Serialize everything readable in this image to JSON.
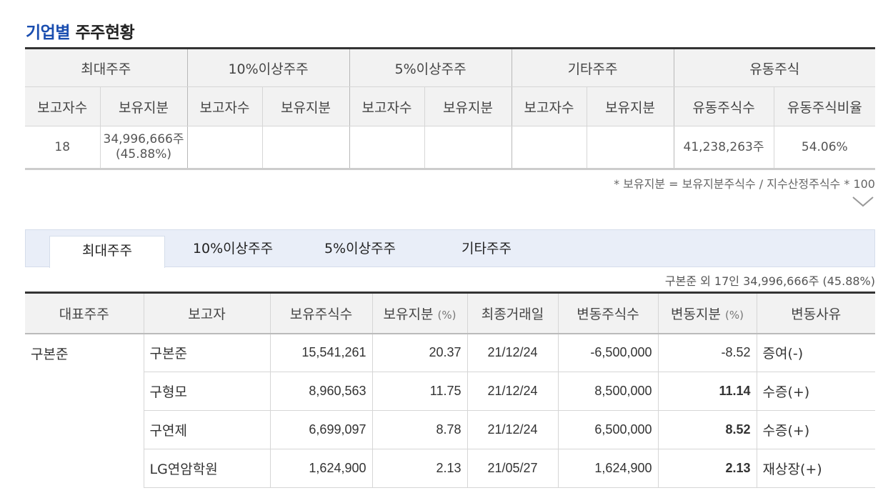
{
  "title": {
    "highlight": "기업별",
    "rest": "주주현황"
  },
  "summary": {
    "groups": [
      "최대주주",
      "10%이상주주",
      "5%이상주주",
      "기타주주",
      "유동주식"
    ],
    "subheaders": [
      "보고자수",
      "보유지분",
      "보고자수",
      "보유지분",
      "보고자수",
      "보유지분",
      "보고자수",
      "보유지분",
      "유동주식수",
      "유동주식비율"
    ],
    "row": {
      "largest_count": "18",
      "largest_shares": "34,996,666주",
      "largest_ratio": "(45.88%)",
      "pct10_count": "",
      "pct10_shares": "",
      "pct5_count": "",
      "pct5_shares": "",
      "other_count": "",
      "other_shares": "",
      "float_shares": "41,238,263주",
      "float_ratio": "54.06%"
    },
    "note": "* 보유지분 = 보유지분주식수 / 지수산정주식수 * 100"
  },
  "tabs": [
    "최대주주",
    "10%이상주주",
    "5%이상주주",
    "기타주주"
  ],
  "detail": {
    "summary_note": "구본준 외 17인 34,996,666주 (45.88%)",
    "headers": {
      "rep": "대표주주",
      "reporter": "보고자",
      "shares": "보유주식수",
      "ratio": "보유지분",
      "ratio_unit": "(%)",
      "last_trade": "최종거래일",
      "change_shares": "변동주식수",
      "change_ratio": "변동지분",
      "change_ratio_unit": "(%)",
      "reason": "변동사유"
    },
    "rows": [
      {
        "rep": "구본준",
        "reporter": "구본준",
        "shares": "15,541,261",
        "ratio": "20.37",
        "date": "21/12/24",
        "change": "-6,500,000",
        "change_ratio": "-8.52",
        "reason": "증여(-)"
      },
      {
        "rep": "",
        "reporter": "구형모",
        "shares": "8,960,563",
        "ratio": "11.75",
        "date": "21/12/24",
        "change": "8,500,000",
        "change_ratio": "11.14",
        "reason": "수증(+)"
      },
      {
        "rep": "",
        "reporter": "구연제",
        "shares": "6,699,097",
        "ratio": "8.78",
        "date": "21/12/24",
        "change": "6,500,000",
        "change_ratio": "8.52",
        "reason": "수증(+)"
      },
      {
        "rep": "",
        "reporter": "LG연암학원",
        "shares": "1,624,900",
        "ratio": "2.13",
        "date": "21/05/27",
        "change": "1,624,900",
        "change_ratio": "2.13",
        "reason": "재상장(+)"
      }
    ]
  },
  "colors": {
    "accent": "#1a4eb0",
    "negative": "#d0021b"
  }
}
